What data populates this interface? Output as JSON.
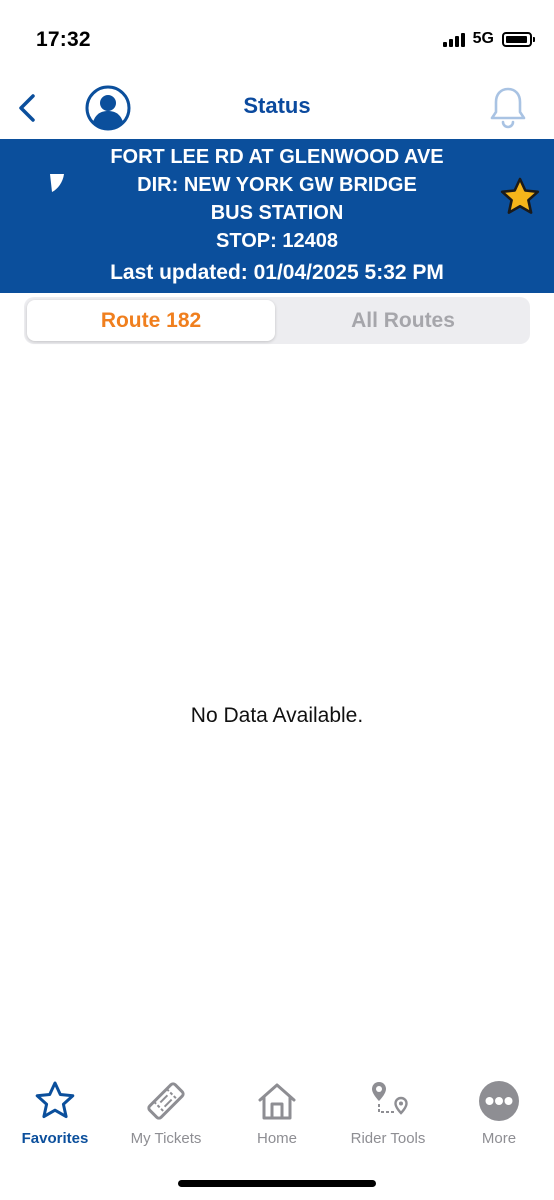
{
  "status_bar": {
    "time": "17:32",
    "network": "5G",
    "icons": [
      "signal-bars-icon",
      "battery-icon"
    ]
  },
  "nav": {
    "title": "Status",
    "icons": [
      "chevron-left-icon",
      "profile-icon",
      "bell-icon"
    ]
  },
  "stop": {
    "lines": [
      "FORT LEE RD AT GLENWOOD AVE",
      "DIR: NEW YORK GW BRIDGE",
      "BUS STATION",
      "STOP: 12408"
    ],
    "last_updated": "Last updated: 01/04/2025 5:32 PM",
    "favorite_icon": "star-icon",
    "favorited": true
  },
  "segments": {
    "selected": "Route 182",
    "other": "All Routes"
  },
  "content": {
    "empty_message": "No Data Available."
  },
  "tabs": [
    {
      "label": "Favorites",
      "icon": "star-icon",
      "active": true
    },
    {
      "label": "My Tickets",
      "icon": "ticket-icon",
      "active": false
    },
    {
      "label": "Home",
      "icon": "home-icon",
      "active": false
    },
    {
      "label": "Rider Tools",
      "icon": "route-pins-icon",
      "active": false
    },
    {
      "label": "More",
      "icon": "more-dots-icon",
      "active": false
    }
  ],
  "colors": {
    "brand_blue": "#0b4f9c",
    "accent_orange": "#f07f1e",
    "star_gold": "#f5b51a",
    "inactive_gray": "#8e8e93"
  }
}
